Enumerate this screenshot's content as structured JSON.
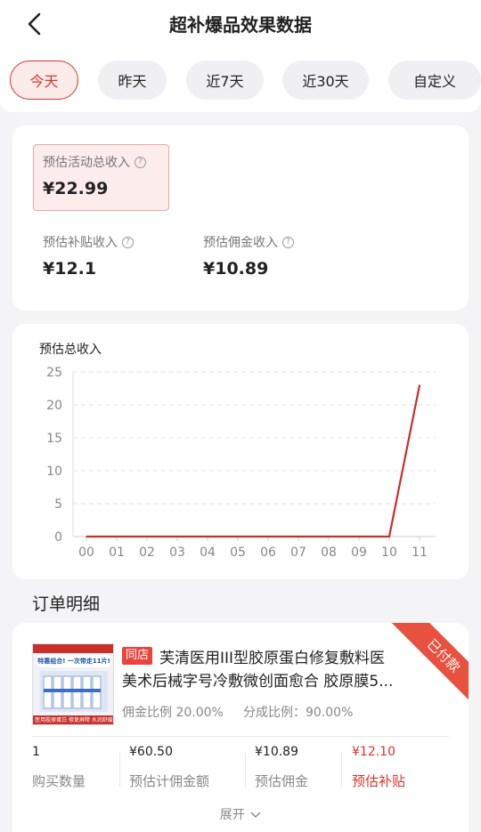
{
  "header": {
    "title": "超补爆品效果数据"
  },
  "tabs": [
    {
      "label": "今天",
      "active": true
    },
    {
      "label": "昨天",
      "active": false
    },
    {
      "label": "近7天",
      "active": false
    },
    {
      "label": "近30天",
      "active": false
    },
    {
      "label": "自定义",
      "active": false
    }
  ],
  "summary": {
    "total_label": "预估活动总收入",
    "total_value": "¥22.99",
    "subsidy_label": "预估补贴收入",
    "subsidy_value": "¥12.1",
    "commission_label": "预估佣金收入",
    "commission_value": "¥10.89"
  },
  "chart_data": {
    "type": "line",
    "title": "预估总收入",
    "x": [
      "00",
      "01",
      "02",
      "03",
      "04",
      "05",
      "06",
      "07",
      "08",
      "09",
      "10",
      "11"
    ],
    "series": [
      {
        "values": [
          0,
          0,
          0,
          0,
          0,
          0,
          0,
          0,
          0,
          0,
          0,
          22.99
        ]
      }
    ],
    "ylim": [
      0,
      25
    ],
    "yticks": [
      0,
      5,
      10,
      15,
      20,
      25
    ],
    "grid": true,
    "colors": {
      "line": "#c9302c",
      "grid": "#e2e2e2",
      "tick_label": "#888888"
    }
  },
  "orders": {
    "section_title": "订单明细",
    "item": {
      "status": "已付款",
      "store_tag": "同店",
      "name_line1": "芙清医用III型胶原蛋白修复敷料医",
      "name_line2": "美术后械字号冷敷微创面愈合 胶原膜5...",
      "commission_rate": "佣金比例 20.00%",
      "share_rate": "分成比例：90.00%",
      "thumb_banner": "特惠组合! 一次带走11片!",
      "thumb_caption": "医用胶原蛋白 修复屏障 水润舒缓",
      "stats": [
        {
          "value": "1",
          "label": "购买数量",
          "highlight": false
        },
        {
          "value": "¥60.50",
          "label": "预估计佣金额",
          "highlight": false
        },
        {
          "value": "¥10.89",
          "label": "预估佣金",
          "highlight": false
        },
        {
          "value": "¥12.10",
          "label": "预估补贴",
          "highlight": true
        }
      ],
      "expand_label": "展开"
    }
  },
  "icons": {
    "back": "chevron-left-icon",
    "help": "question-circle-icon",
    "expand": "chevron-down-icon"
  }
}
